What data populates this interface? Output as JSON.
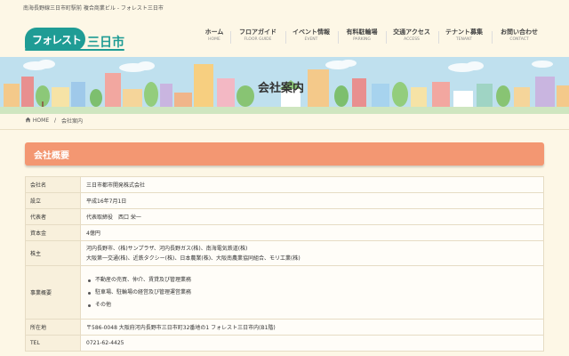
{
  "header": {
    "tagline": "南海長野線三日市町駅前 複合商業ビル - フォレスト三日市",
    "logo": {
      "name": "フォレスト",
      "city": "三日市"
    }
  },
  "nav": [
    {
      "jp": "ホーム",
      "en": "HOME"
    },
    {
      "jp": "フロアガイド",
      "en": "FLOOR GUIDE"
    },
    {
      "jp": "イベント情報",
      "en": "EVENT"
    },
    {
      "jp": "有料駐輪場",
      "en": "PARKING"
    },
    {
      "jp": "交通アクセス",
      "en": "ACCESS"
    },
    {
      "jp": "テナント募集",
      "en": "TENANT"
    },
    {
      "jp": "お問い合わせ",
      "en": "CONTACT"
    }
  ],
  "banner": {
    "title": "会社案内"
  },
  "breadcrumb": {
    "home": "HOME",
    "separator": "/",
    "current": "会社案内"
  },
  "section": {
    "title": "会社概要"
  },
  "company": {
    "rows": [
      {
        "label": "会社名",
        "value": "三日市都市開発株式会社"
      },
      {
        "label": "設立",
        "value": "平成16年7月1日"
      },
      {
        "label": "代表者",
        "value": "代表取締役　西口 栄一"
      },
      {
        "label": "資本金",
        "value": "4億円"
      }
    ],
    "shareholders": {
      "label": "株主",
      "lines": [
        "河内長野市、(株)サンプラザ、河内長野ガス(株)、南海電気鉄道(株)",
        "大阪第一交通(株)、近鉄タクシー(株)、日本農業(株)、大阪南農業協同組合、モリ工業(株)"
      ]
    },
    "business": {
      "label": "事業概要",
      "items": [
        "不動産の売買、仲介、賃貸及び管理業務",
        "駐車場、駐輪場の経営及び管理運営業務",
        "その他"
      ]
    },
    "address": {
      "label": "所在地",
      "value": "〒586-0048 大阪府河内長野市三日市町32番地の1 フォレスト三日市内(B1階)"
    },
    "tel": {
      "label": "TEL",
      "value": "0721-62-4425"
    }
  },
  "colors": {
    "brand": "#1f9c95",
    "section_header": "#f39772",
    "page_bg": "#fdf7e6",
    "sky": "#bfe0ee"
  },
  "icons": {
    "breadcrumb_home": "home-icon",
    "bullet": "bullet-icon"
  }
}
